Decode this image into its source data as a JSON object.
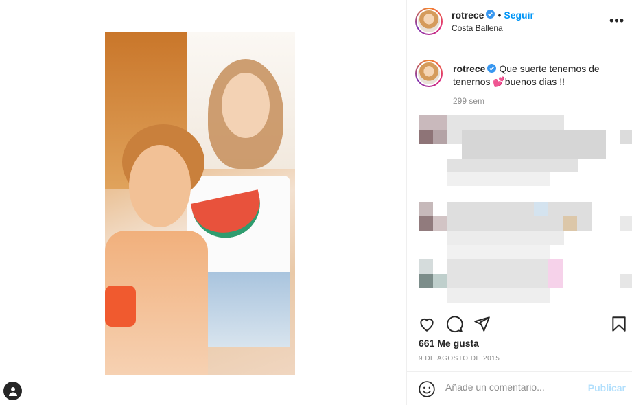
{
  "post": {
    "username": "rotrece",
    "follow_label": "Seguir",
    "dot": "•",
    "location": "Costa Ballena",
    "more_label": "•••"
  },
  "caption": {
    "username": "rotrece",
    "text": "Que suerte tenemos de tenernos 💕buenos dias !!",
    "time_ago": "299 sem"
  },
  "actions": {
    "likes": "661 Me gusta",
    "date": "9 DE AGOSTO DE 2015"
  },
  "comment_box": {
    "placeholder": "Añade un comentario...",
    "publish_label": "Publicar"
  },
  "colors": {
    "accent": "#0095f6",
    "verified": "#3897f0",
    "publish_disabled": "#b2dffc",
    "secondary_text": "#8e8e8e"
  },
  "icons": [
    "verified-badge-icon",
    "more-options-icon",
    "heart-icon",
    "comment-icon",
    "share-icon",
    "bookmark-icon",
    "emoji-icon",
    "user-icon"
  ]
}
